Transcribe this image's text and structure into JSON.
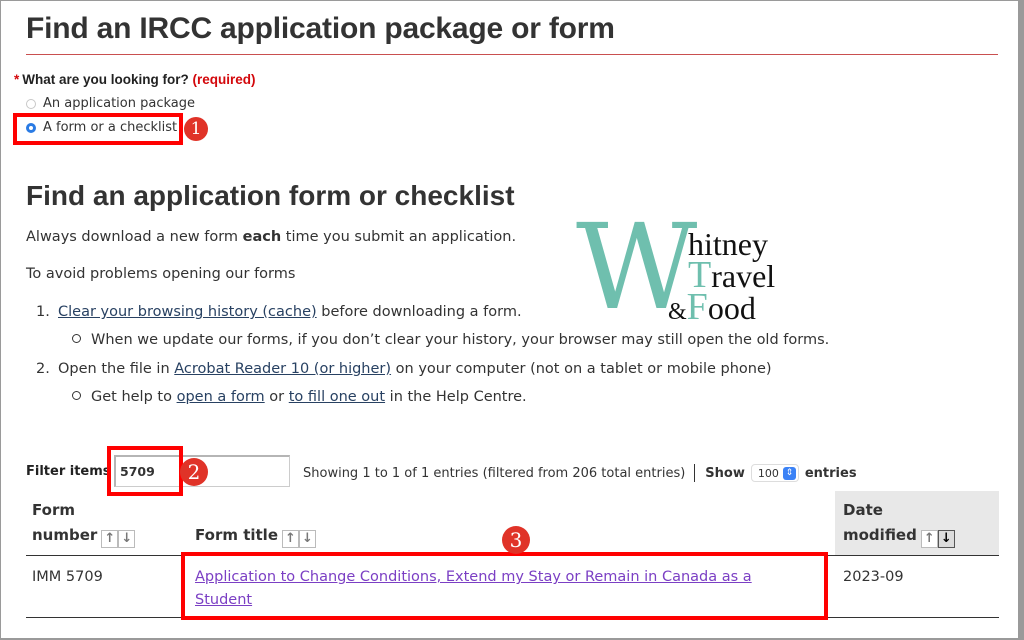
{
  "page": {
    "title": "Find an IRCC application package or form"
  },
  "question": {
    "label": "What are you looking for?",
    "required_marker": "*",
    "required_text": "(required)",
    "options": [
      {
        "label": "An application package",
        "checked": false
      },
      {
        "label": "A form or a checklist",
        "checked": true
      }
    ]
  },
  "section": {
    "title": "Find an application form or checklist",
    "intro_before": "Always download a new form ",
    "intro_bold": "each",
    "intro_after": " time you submit an application.",
    "avoid_text": "To avoid problems opening our forms",
    "steps": [
      {
        "number": "1.",
        "link": "Clear your browsing history (cache)",
        "after": " before downloading a form.",
        "sub": "When we update our forms, if you don’t clear your history, your browser may still open the old forms."
      },
      {
        "number": "2.",
        "before": "Open the file in ",
        "link": "Acrobat Reader 10 (or higher)",
        "after": " on your computer (not on a tablet or mobile phone)",
        "sub_before": "Get help to ",
        "sub_link1": "open a form",
        "sub_mid": " or ",
        "sub_link2": "to fill one out",
        "sub_after": " in the Help Centre."
      }
    ]
  },
  "watermark": {
    "big_letter": "W",
    "line1": "hitney",
    "line2_cap": "T",
    "line2": "ravel",
    "line3_amp": "&",
    "line3_cap": "F",
    "line3": "ood"
  },
  "filter": {
    "label": "Filter items",
    "value": "5709",
    "showing": "Showing 1 to 1 of 1 entries (filtered from 206 total entries)",
    "show_label": "Show",
    "page_size": "100",
    "entries_label": "entries"
  },
  "table": {
    "headers": [
      {
        "line1": "Form",
        "line2": "number",
        "sort": "none"
      },
      {
        "line1": "",
        "line2": "Form title",
        "sort": "none"
      },
      {
        "line1": "Date",
        "line2": "modified",
        "sort": "descending"
      }
    ],
    "rows": [
      {
        "form_number": "IMM 5709",
        "title_line1": "Application to Change Conditions, Extend my Stay or Remain in Canada as a",
        "title_line2": "Student",
        "date_modified": "2023-09"
      }
    ]
  },
  "annotations": {
    "step1": "1",
    "step2": "2",
    "step3": "3",
    "highlight_color": "#ff0000",
    "badge_color": "#e03328"
  },
  "icons": {
    "sort_up": "↑",
    "sort_down": "↓",
    "select_chevron": "⇕",
    "bullet": "circle"
  },
  "colors": {
    "heading_rule": "#c94f4f",
    "required": "#d3080c",
    "link": "#284162",
    "visited_link": "#7b3fc4",
    "radio_selected": "#2a7be4",
    "logo_teal": "#6fbfae"
  }
}
